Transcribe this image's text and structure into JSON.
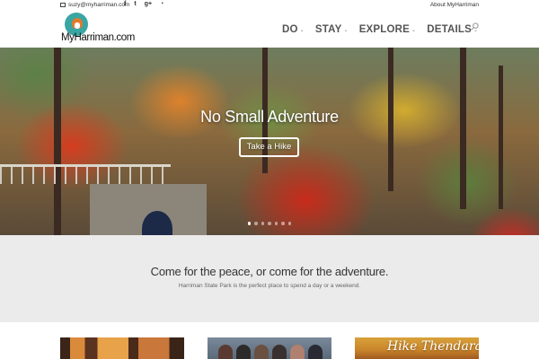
{
  "topbar": {
    "email": "suzy@myharriman.com",
    "social_icons": [
      "facebook-icon",
      "twitter-icon",
      "google-plus-icon",
      "rss-icon"
    ],
    "social_glyphs": [
      "f",
      "t",
      "g+",
      "◔"
    ],
    "about_link": "About MyHarriman"
  },
  "header": {
    "logo_text": "MyHarriman.com",
    "nav": [
      {
        "label": "DO",
        "chevron": "⌄"
      },
      {
        "label": "STAY",
        "chevron": "⌄"
      },
      {
        "label": "EXPLORE",
        "chevron": "⌄"
      },
      {
        "label": "DETAILS",
        "chevron": "⌄"
      }
    ]
  },
  "hero": {
    "title": "No Small Adventure",
    "button": "Take a Hike",
    "slide_count": 7,
    "active_slide": 1
  },
  "intro": {
    "heading": "Come for the peace, or come for the adventure.",
    "text": "Harriman State Park is the perfect place to spend a day or a weekend."
  },
  "cards": {
    "card3_title": "Hike Thendara"
  },
  "colors": {
    "nav_text": "#555555",
    "intro_bg": "#ebebeb",
    "logo_teal": "#3aa6a3"
  }
}
